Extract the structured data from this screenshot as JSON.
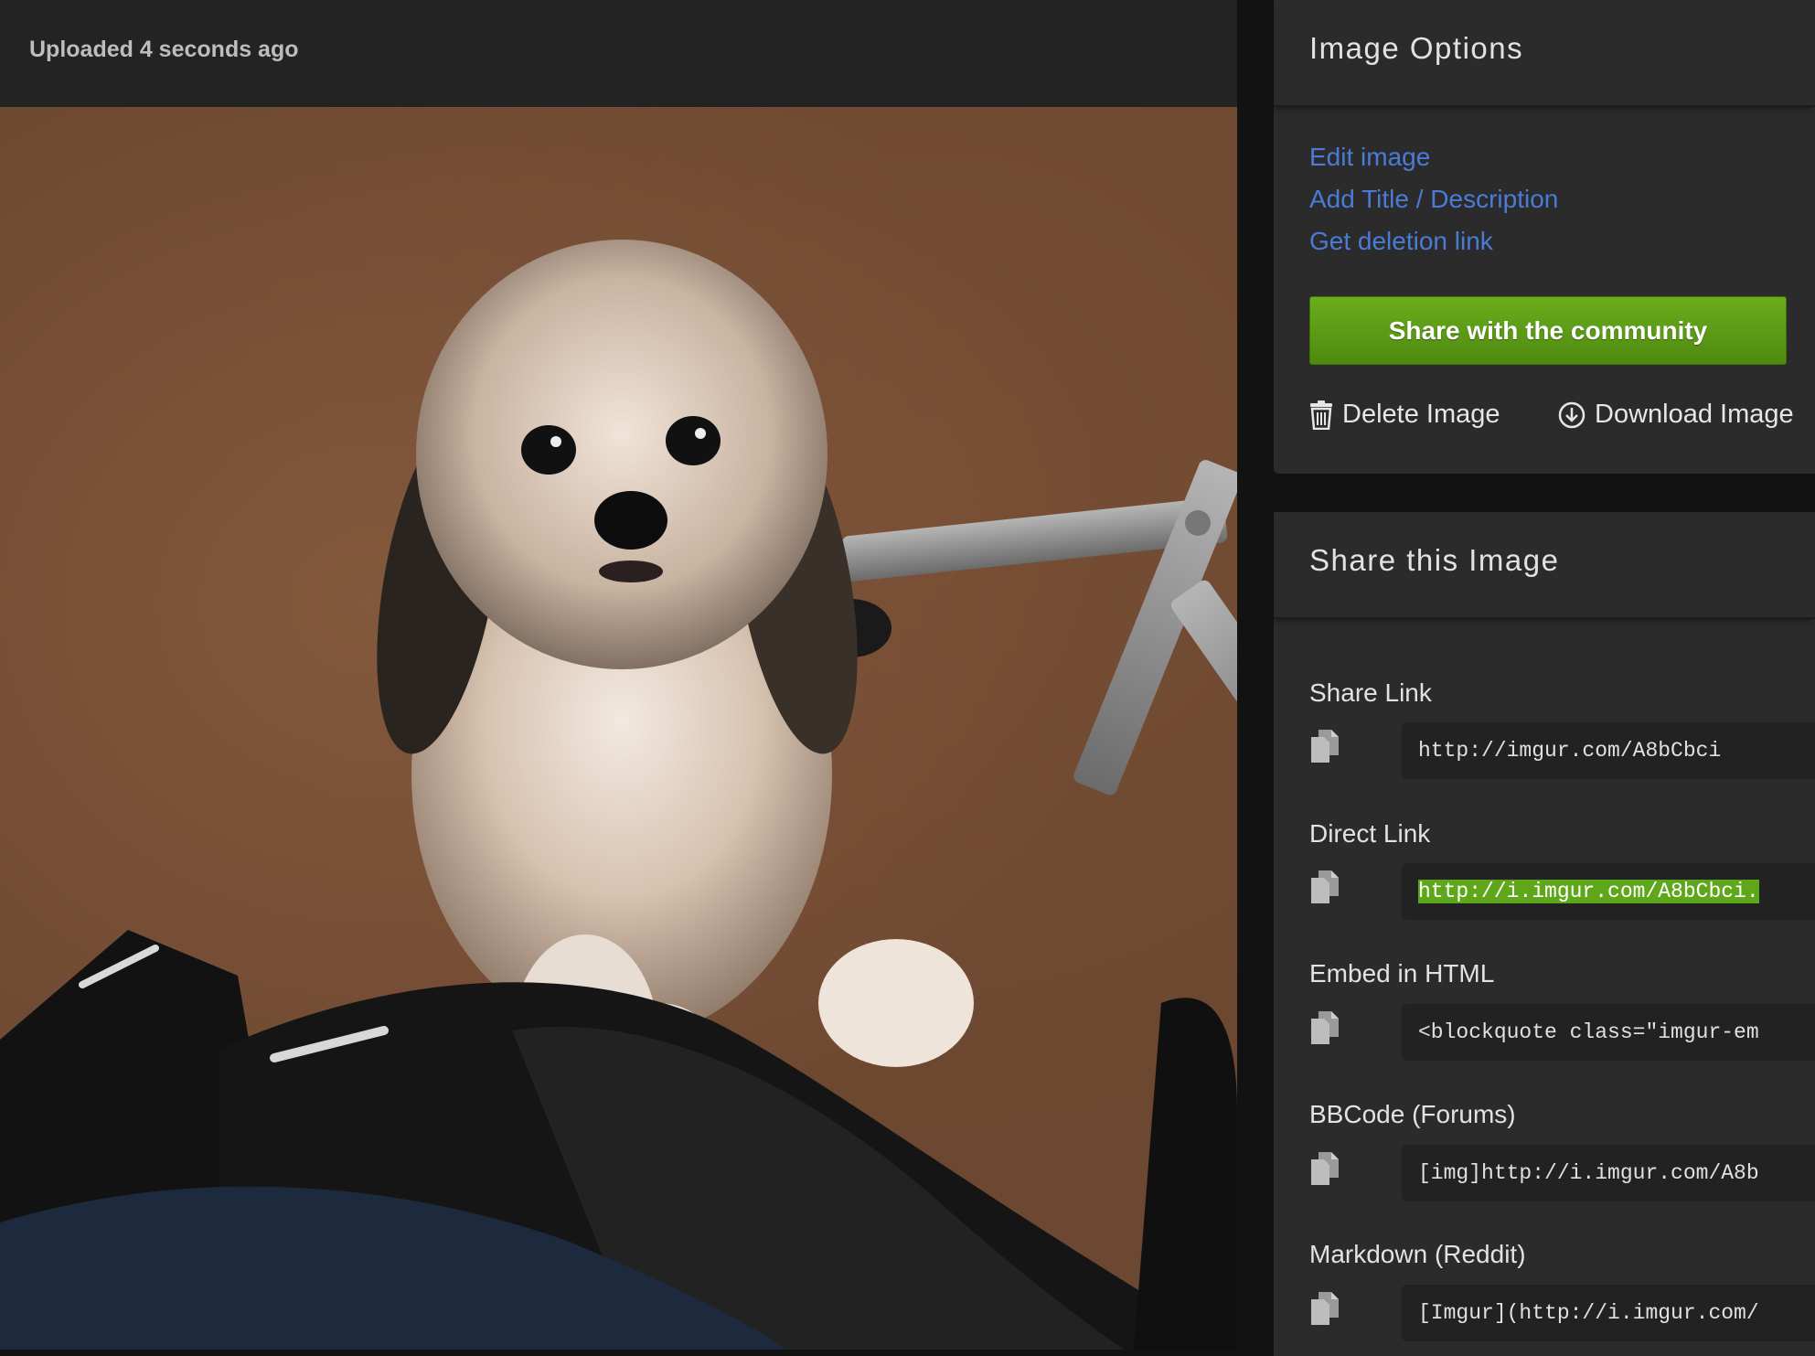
{
  "upload": {
    "status_text": "Uploaded 4 seconds ago"
  },
  "image_options": {
    "title": "Image Options",
    "links": [
      "Edit image",
      "Add Title / Description",
      "Get deletion link"
    ],
    "share_button": "Share with the community",
    "delete_label": "Delete Image",
    "download_label": "Download Image"
  },
  "share_image": {
    "title": "Share this Image",
    "fields": [
      {
        "label": "Share Link",
        "value": "http://imgur.com/A8bCbci"
      },
      {
        "label": "Direct Link",
        "value": "http://i.imgur.com/A8bCbci."
      },
      {
        "label": "Embed in HTML",
        "value": "<blockquote class=\"imgur-em"
      },
      {
        "label": "BBCode (Forums)",
        "value": "[img]http://i.imgur.com/A8b"
      },
      {
        "label": "Markdown (Reddit)",
        "value": "[Imgur](http://i.imgur.com/"
      }
    ]
  },
  "colors": {
    "link": "#4a7bd6",
    "share_button": "#5fa71a",
    "selection": "#5fa71a",
    "panel": "#2b2b2b"
  },
  "icons": [
    "trash-icon",
    "download-icon",
    "copy-icon"
  ]
}
